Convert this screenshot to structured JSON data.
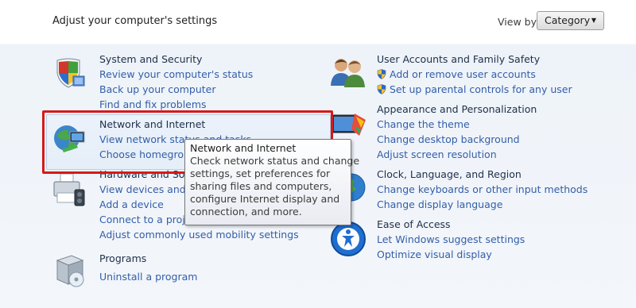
{
  "header": {
    "title": "Adjust your computer's settings",
    "view_by_label": "View by:",
    "view_by_value": "Category"
  },
  "left_categories": [
    {
      "title": "System and Security",
      "icon": "shield-icon",
      "links": [
        "Review your computer's status",
        "Back up your computer",
        "Find and fix problems"
      ]
    },
    {
      "title": "Network and Internet",
      "icon": "network-globe-icon",
      "links": [
        "View network status and tasks",
        "Choose homegroup and sharing options"
      ]
    },
    {
      "title": "Hardware and Sound",
      "icon": "printer-icon",
      "links": [
        "View devices and printers",
        "Add a device",
        "Connect to a projector",
        "Adjust commonly used mobility settings"
      ]
    },
    {
      "title": "Programs",
      "icon": "programs-box-icon",
      "links": [
        "Uninstall a program"
      ]
    }
  ],
  "right_categories": [
    {
      "title": "User Accounts and Family Safety",
      "icon": "users-icon",
      "links": [
        "Add or remove user accounts",
        "Set up parental controls for any user"
      ]
    },
    {
      "title": "Appearance and Personalization",
      "icon": "appearance-monitor-icon",
      "links": [
        "Change the theme",
        "Change desktop background",
        "Adjust screen resolution"
      ]
    },
    {
      "title": "Clock, Language, and Region",
      "icon": "clock-globe-icon",
      "links": [
        "Change keyboards or other input methods",
        "Change display language"
      ]
    },
    {
      "title": "Ease of Access",
      "icon": "ease-of-access-icon",
      "links": [
        "Let Windows suggest settings",
        "Optimize visual display"
      ]
    }
  ],
  "tooltip": {
    "title": "Network and Internet",
    "lines": [
      "Check network status and change",
      "settings, set preferences for",
      "sharing files and computers,",
      "configure Internet display and",
      "connection, and more."
    ]
  },
  "colors": {
    "link": "#335ea8",
    "annotation_red": "#d41a1a"
  }
}
